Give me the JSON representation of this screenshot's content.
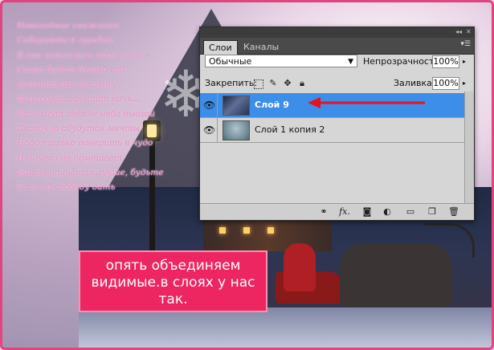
{
  "poem": {
    "lines": [
      "Новогодние снежинки",
      "Собираются гурьбой,",
      "В сон затаились люди алые -",
      "Скоро будет Новый год",
      "Заменят былые огни,",
      "Фейерверк осветит ночь...",
      "Вспыхнут звёзды неба вьюгой",
      "Сказочно сбудутся мечты",
      "Надо только поверить в чудо",
      "И ничего не помешает",
      "Жизнь начнётся лучше, будьте",
      "Если ей свободу дать"
    ]
  },
  "panel": {
    "title_controls": {
      "collapse": "◂◂",
      "close": "✕"
    },
    "tabs": [
      {
        "label": "Слои",
        "active": true
      },
      {
        "label": "Каналы",
        "active": false
      }
    ],
    "menu_icon": "panel-menu-icon",
    "blend_mode": "Обычные",
    "opacity_label": "Непрозрачность:",
    "opacity_value": "100%",
    "lock_label": "Закрепить:",
    "fill_label": "Заливка:",
    "fill_value": "100%",
    "layers": [
      {
        "name": "Слой 9",
        "selected": true,
        "visible": true
      },
      {
        "name": "Слой 1 копия 2",
        "selected": false,
        "visible": true
      }
    ],
    "footer_icons": [
      "link-icon",
      "fx-icon",
      "mask-icon",
      "adjustment-icon",
      "folder-icon",
      "new-layer-icon",
      "trash-icon"
    ],
    "fx_label": "fx."
  },
  "caption": {
    "line1": "опять объединяем",
    "line2": "видимые.в слоях у нас",
    "line3": "так."
  },
  "colors": {
    "frame_border": "#e0457f",
    "caption_bg": "#ed2561",
    "selected_layer": "#3c8ee8",
    "arrow": "#e8121c",
    "poem_text": "#ea9ad0"
  }
}
